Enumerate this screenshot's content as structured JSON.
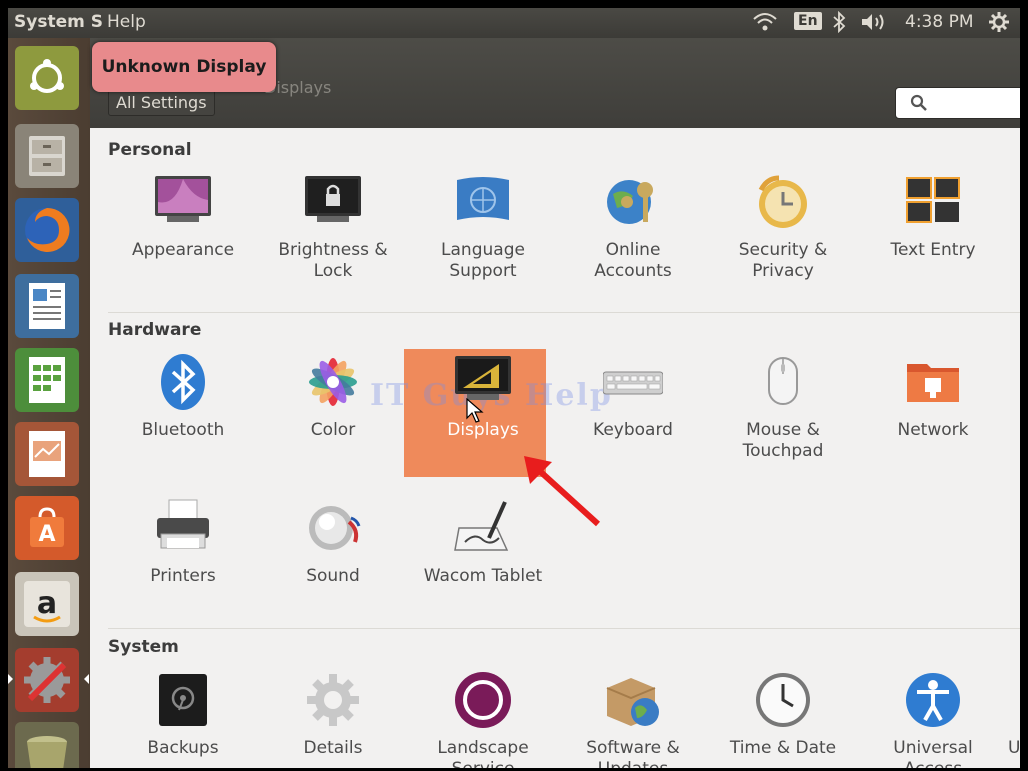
{
  "panel": {
    "menu_system": "System S",
    "menu_help": "Help",
    "keyboard_layout": "En",
    "clock": "4:38 PM"
  },
  "window": {
    "title": "Displays",
    "all_settings_button": "All Settings",
    "tooltip": "Unknown Display",
    "search_placeholder": ""
  },
  "sections": {
    "personal": {
      "title": "Personal",
      "items": [
        {
          "label": "Appearance",
          "icon": "appearance-icon"
        },
        {
          "label": "Brightness &\nLock",
          "icon": "brightness-lock-icon"
        },
        {
          "label": "Language\nSupport",
          "icon": "language-support-icon"
        },
        {
          "label": "Online\nAccounts",
          "icon": "online-accounts-icon"
        },
        {
          "label": "Security &\nPrivacy",
          "icon": "security-privacy-icon"
        },
        {
          "label": "Text Entry",
          "icon": "text-entry-icon"
        }
      ]
    },
    "hardware": {
      "title": "Hardware",
      "items": [
        {
          "label": "Bluetooth",
          "icon": "bluetooth-icon"
        },
        {
          "label": "Color",
          "icon": "color-icon"
        },
        {
          "label": "Displays",
          "icon": "displays-icon"
        },
        {
          "label": "Keyboard",
          "icon": "keyboard-icon"
        },
        {
          "label": "Mouse &\nTouchpad",
          "icon": "mouse-touchpad-icon"
        },
        {
          "label": "Network",
          "icon": "network-icon"
        },
        {
          "label": "Printers",
          "icon": "printers-icon"
        },
        {
          "label": "Sound",
          "icon": "sound-icon"
        },
        {
          "label": "Wacom Tablet",
          "icon": "wacom-tablet-icon"
        }
      ]
    },
    "system": {
      "title": "System",
      "items": [
        {
          "label": "Backups",
          "icon": "backups-icon"
        },
        {
          "label": "Details",
          "icon": "details-icon"
        },
        {
          "label": "Landscape\nService",
          "icon": "landscape-service-icon"
        },
        {
          "label": "Software &\nUpdates",
          "icon": "software-updates-icon"
        },
        {
          "label": "Time & Date",
          "icon": "time-date-icon"
        },
        {
          "label": "Universal\nAccess",
          "icon": "universal-access-icon"
        },
        {
          "label": "U",
          "icon": "user-accounts-icon"
        }
      ]
    }
  },
  "watermark": "IT Guys Help",
  "colors": {
    "selection": "#ef8a5b",
    "tooltip": "#e88a8c",
    "panel": "#3c3b37",
    "arrow": "#e81d1d"
  }
}
